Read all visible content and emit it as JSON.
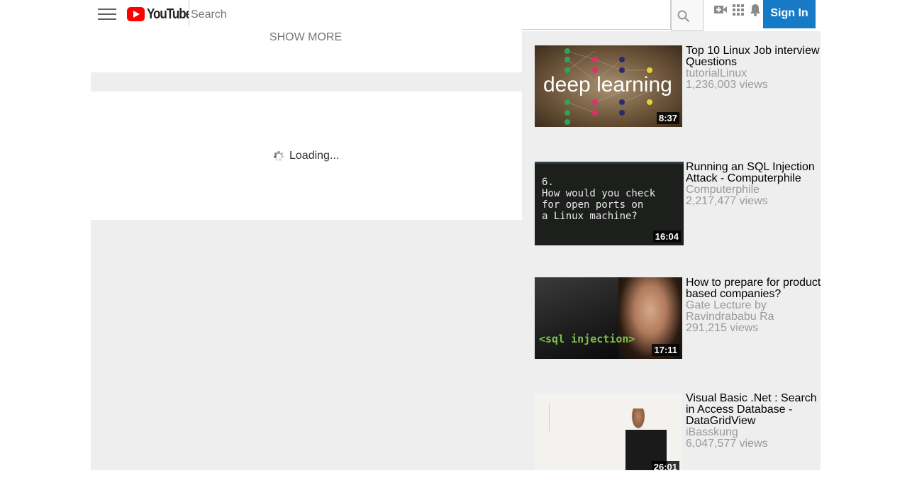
{
  "header": {
    "logo_text": "YouTube",
    "search_placeholder": "Search",
    "sign_in_label": "Sign In"
  },
  "main": {
    "show_more_label": "SHOW MORE",
    "loading_text": "Loading..."
  },
  "sidebar": {
    "videos": [
      {
        "title": "Top 10 Linux Job interview Questions",
        "channel": "tutorialLinux",
        "views": "1,236,003 views",
        "duration": "8:37",
        "thumb_text": "deep learning"
      },
      {
        "title": "Running an SQL Injection Attack - Computerphile",
        "channel": "Computerphile",
        "views": "2,217,477 views",
        "duration": "16:04",
        "thumb_text": "6.\nHow would you check\nfor open ports on\na Linux machine?"
      },
      {
        "title": "How to prepare for product based companies?",
        "channel": "Gate Lecture by Ravindrababu Ra",
        "views": "291,215 views",
        "duration": "17:11",
        "thumb_text": "<sql injection>"
      },
      {
        "title": "Visual Basic .Net : Search in Access Database - DataGridView",
        "channel": "iBasskung",
        "views": "6,047,577 views",
        "duration": "26:01",
        "thumb_text": ""
      }
    ]
  },
  "colors": {
    "brand_red": "#ff0000",
    "sign_in_blue": "#167ac6",
    "page_bg": "#eeeeee"
  }
}
